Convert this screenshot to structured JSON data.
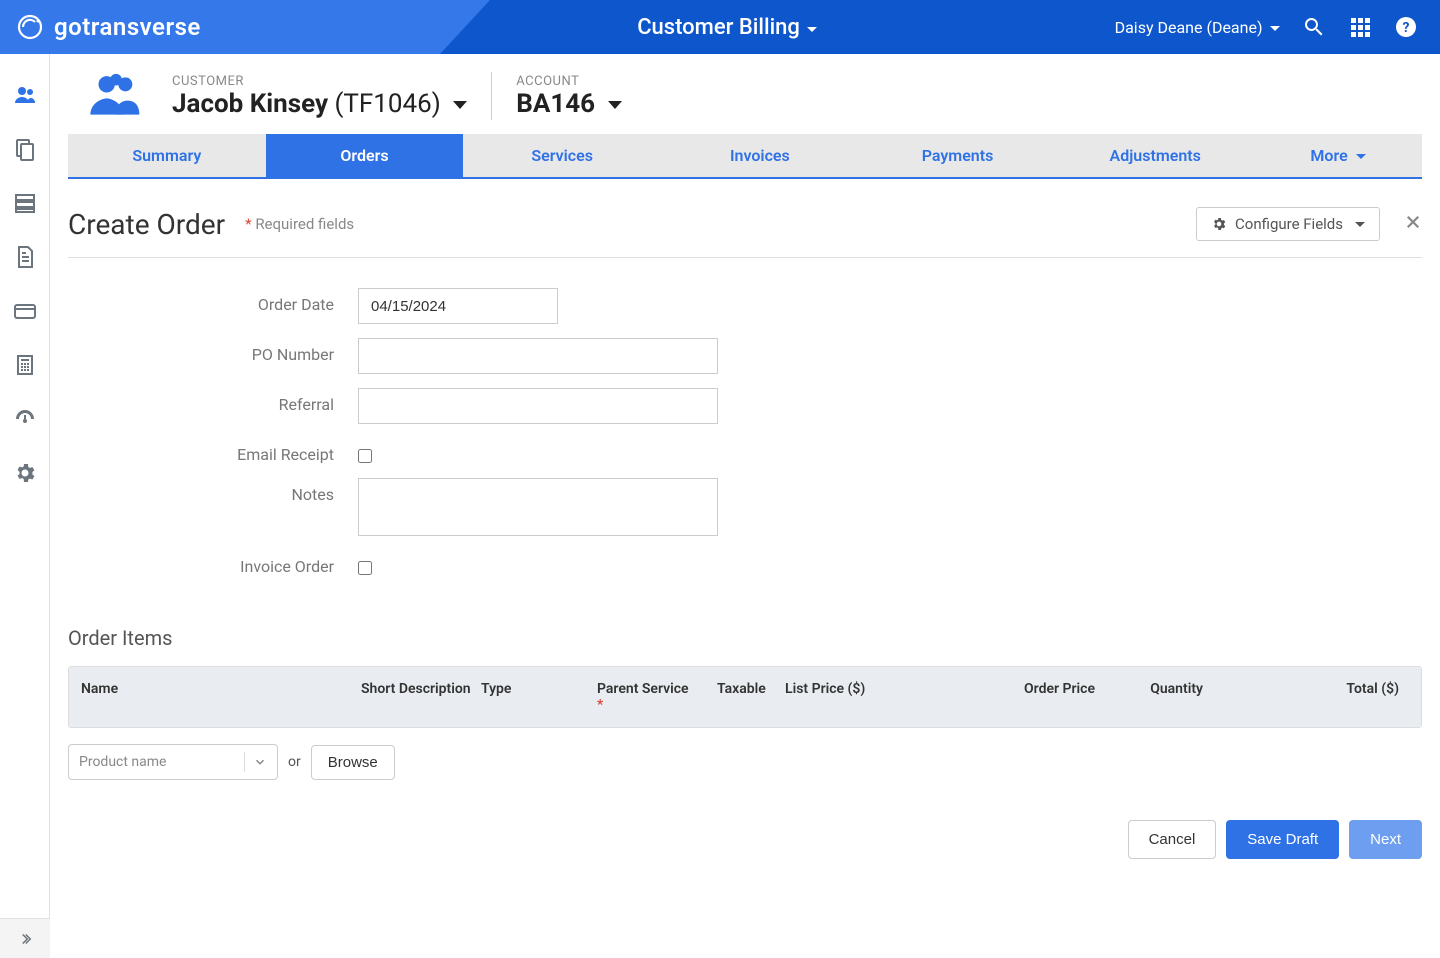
{
  "header": {
    "brand": "gotransverse",
    "title": "Customer Billing",
    "user": "Daisy Deane (Deane)"
  },
  "account_header": {
    "customer_label": "CUSTOMER",
    "customer_name": "Jacob Kinsey",
    "customer_code": "(TF1046)",
    "account_label": "ACCOUNT",
    "account_value": "BA146"
  },
  "tabs": {
    "summary": "Summary",
    "orders": "Orders",
    "services": "Services",
    "invoices": "Invoices",
    "payments": "Payments",
    "adjustments": "Adjustments",
    "more": "More"
  },
  "page": {
    "title": "Create Order",
    "required_note": "Required fields",
    "configure": "Configure Fields"
  },
  "form": {
    "order_date_label": "Order Date",
    "order_date_value": "04/15/2024",
    "po_label": "PO Number",
    "referral_label": "Referral",
    "email_label": "Email Receipt",
    "notes_label": "Notes",
    "invoice_label": "Invoice Order"
  },
  "order_items": {
    "title": "Order Items",
    "cols": {
      "name": "Name",
      "desc": "Short Description",
      "type": "Type",
      "parent": "Parent Service",
      "taxable": "Taxable",
      "listprice": "List Price ($)",
      "orderprice": "Order Price",
      "qty": "Quantity",
      "total": "Total ($)"
    },
    "product_placeholder": "Product name",
    "or": "or",
    "browse": "Browse"
  },
  "buttons": {
    "cancel": "Cancel",
    "save_draft": "Save Draft",
    "next": "Next"
  }
}
